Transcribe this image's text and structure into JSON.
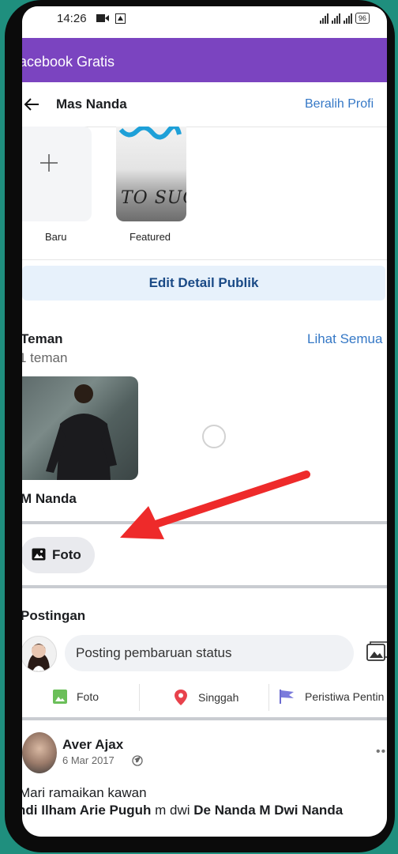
{
  "status_bar": {
    "time": "14:26",
    "battery": "96"
  },
  "app_bar": {
    "title": "acebook Gratis"
  },
  "header": {
    "title": "Mas Nanda",
    "switch_profile": "Beralih Profi"
  },
  "highlights": {
    "new_label": "Baru",
    "featured_label": "Featured",
    "featured_image_text": "TO SUCC"
  },
  "edit_details_button": "Edit Detail Publik",
  "friends": {
    "title": "Teman",
    "count": "1 teman",
    "see_all": "Lihat Semua",
    "items": [
      {
        "name": "M Nanda"
      }
    ]
  },
  "photos_chip": "Foto",
  "posts": {
    "title": "Postingan",
    "composer_placeholder": "Posting pembaruan status",
    "actions": [
      {
        "label": "Foto",
        "icon": "photo-icon"
      },
      {
        "label": "Singgah",
        "icon": "location-pin-icon"
      },
      {
        "label": "Peristiwa Pentin",
        "icon": "flag-icon"
      }
    ],
    "items": [
      {
        "author": "Aver Ajax",
        "date": "6 Mar 2017",
        "text": "Mari ramaikan kawan",
        "tag_1": "ndi Ilham Arie Puguh",
        "connector": " m dwi ",
        "tag_2": "De Nanda M Dwi Nanda"
      }
    ]
  },
  "colors": {
    "app_bar": "#7b44c0",
    "link": "#3578c6",
    "annotation_arrow": "#ee2a2a",
    "background": "#1f8f7e"
  }
}
